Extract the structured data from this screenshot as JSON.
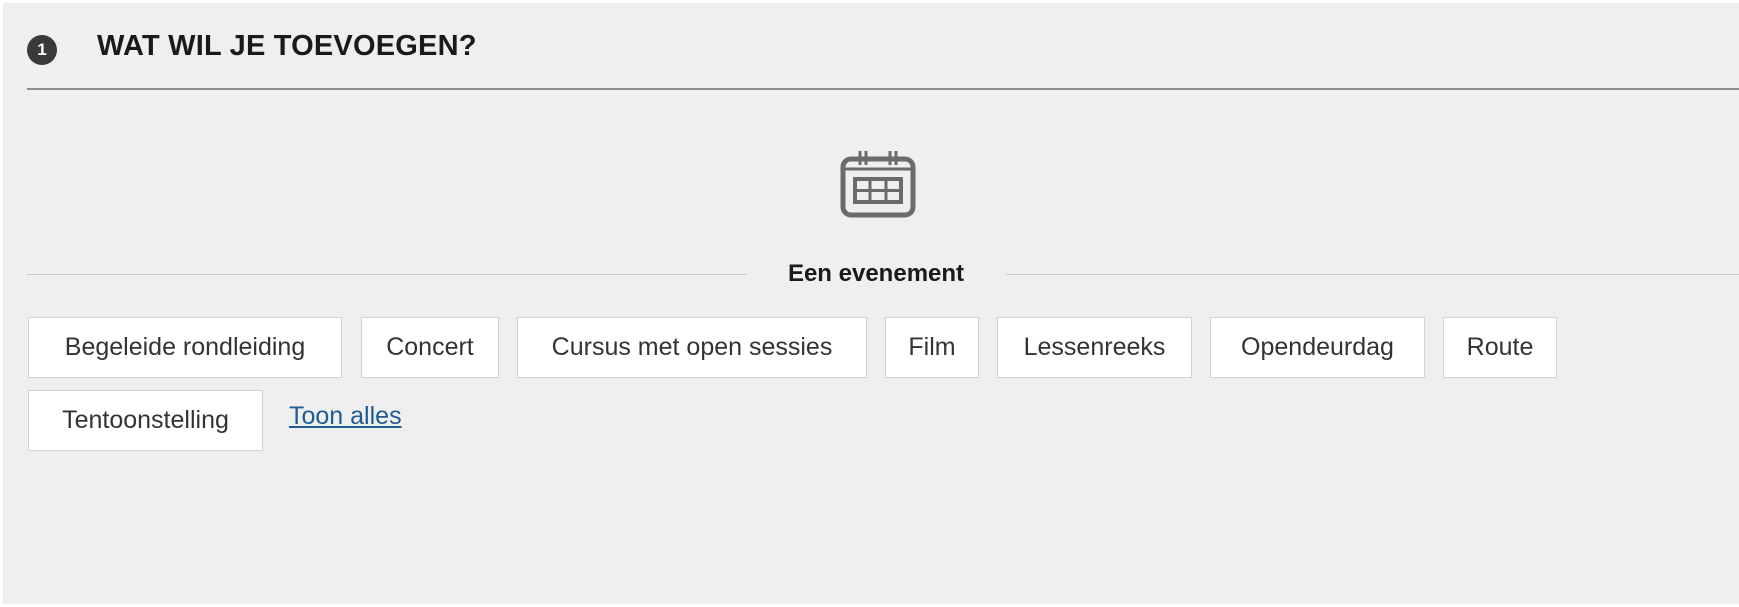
{
  "header": {
    "step_number": "1",
    "title": "WAT WIL JE TOEVOEGEN?"
  },
  "section": {
    "icon": "calendar-icon",
    "label": "Een evenement"
  },
  "types": [
    "Begeleide rondleiding",
    "Concert",
    "Cursus met open sessies",
    "Film",
    "Lessenreeks",
    "Opendeurdag",
    "Route",
    "Tentoonstelling"
  ],
  "show_all_label": "Toon alles",
  "colors": {
    "panel_background": "#efefef",
    "badge": "#3a3a3a",
    "link": "#1e5b94",
    "chip_border": "#d3d3d3"
  }
}
